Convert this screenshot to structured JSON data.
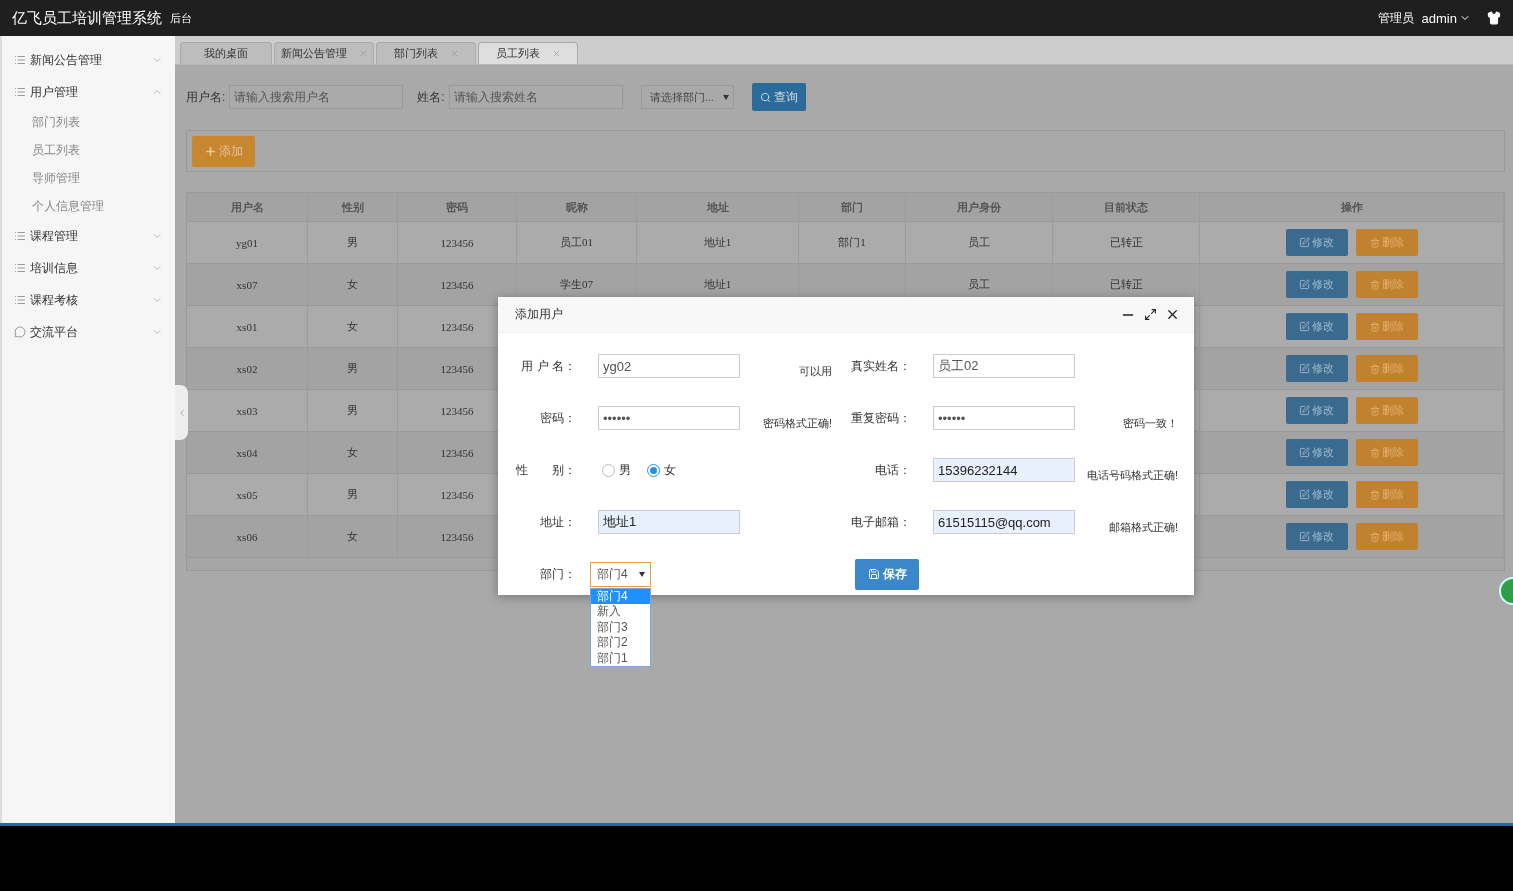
{
  "topbar": {
    "title": "亿飞员工培训管理系统",
    "subtitle": "后台",
    "role": "管理员",
    "user": "admin"
  },
  "sidebar": {
    "items": [
      {
        "label": "新闻公告管理",
        "kind": "menu",
        "expanded": false
      },
      {
        "label": "用户管理",
        "kind": "menu",
        "expanded": true,
        "children": [
          {
            "label": "部门列表"
          },
          {
            "label": "员工列表"
          },
          {
            "label": "导师管理"
          },
          {
            "label": "个人信息管理"
          }
        ]
      },
      {
        "label": "课程管理",
        "kind": "menu",
        "expanded": false
      },
      {
        "label": "培训信息",
        "kind": "menu",
        "expanded": false
      },
      {
        "label": "课程考核",
        "kind": "menu",
        "expanded": false
      },
      {
        "label": "交流平台",
        "kind": "chat",
        "expanded": false
      }
    ]
  },
  "tabs": [
    {
      "label": "我的桌面",
      "closable": false,
      "selected": false
    },
    {
      "label": "新闻公告管理",
      "closable": true,
      "selected": false
    },
    {
      "label": "部门列表",
      "closable": true,
      "selected": false
    },
    {
      "label": "员工列表",
      "closable": true,
      "selected": true
    }
  ],
  "search": {
    "username_label": "用户名:",
    "username_placeholder": "请输入搜索用户名",
    "name_label": "姓名:",
    "name_placeholder": "请输入搜索姓名",
    "department_placeholder": "请选择部门...",
    "query_button": "查询"
  },
  "add_button": "添加",
  "table": {
    "columns": [
      "用户名",
      "性别",
      "密码",
      "昵称",
      "地址",
      "部门",
      "用户身份",
      "目前状态",
      "操作"
    ],
    "rows": [
      {
        "cells": [
          "yg01",
          "男",
          "123456",
          "员工01",
          "地址1",
          "部门1",
          "员工",
          "已转正"
        ],
        "actions": [
          "修改",
          "删除"
        ]
      },
      {
        "cells": [
          "xs07",
          "女",
          "123456",
          "学生07",
          "地址1",
          null,
          "员工",
          "已转正"
        ],
        "actions": [
          "修改",
          "删除"
        ]
      },
      {
        "cells": [
          "xs01",
          "女",
          "123456"
        ],
        "actions": [
          "修改",
          "删除"
        ]
      },
      {
        "cells": [
          "xs02",
          "男",
          "123456"
        ],
        "actions": [
          "修改",
          "删除"
        ]
      },
      {
        "cells": [
          "xs03",
          "男",
          "123456"
        ],
        "actions": [
          "修改",
          "删除"
        ]
      },
      {
        "cells": [
          "xs04",
          "女",
          "123456"
        ],
        "actions": [
          "修改",
          "删除"
        ]
      },
      {
        "cells": [
          "xs05",
          "男",
          "123456"
        ],
        "actions": [
          "修改",
          "删除"
        ]
      },
      {
        "cells": [
          "xs06",
          "女",
          "123456"
        ],
        "actions": [
          "修改",
          "删除"
        ]
      }
    ]
  },
  "dialog": {
    "title": "添加用户",
    "rows": [
      {
        "left": {
          "kind": "input",
          "label": "用 户 名：",
          "value": "yg02",
          "autofilled": false,
          "hint": "可以用"
        },
        "right": {
          "kind": "input",
          "label": "真实姓名：",
          "value": "员工02",
          "autofilled": false
        }
      },
      {
        "left": {
          "kind": "input",
          "label": "密码：",
          "value": "••••••",
          "autofilled": false,
          "hint": "密码格式正确!"
        },
        "right": {
          "kind": "input",
          "label": "重复密码：",
          "value": "••••••",
          "autofilled": false,
          "hint": "密码一致！"
        }
      },
      {
        "left": {
          "kind": "radio",
          "label": "性　　别：",
          "options": [
            {
              "label": "男",
              "selected": false
            },
            {
              "label": "女",
              "selected": true
            }
          ]
        },
        "right": {
          "kind": "input",
          "label": "电话：",
          "value": "15396232144",
          "autofilled": true,
          "hint": "电话号码格式正确!"
        }
      },
      {
        "left": {
          "kind": "input",
          "label": "地址：",
          "value": "地址1",
          "autofilled": true
        },
        "right": {
          "kind": "input",
          "label": "电子邮箱：",
          "value": "61515115@qq.com",
          "autofilled": true,
          "hint": "邮箱格式正确!"
        }
      },
      {
        "left": {
          "kind": "select",
          "label": "部门：",
          "value": "部门4",
          "options": [
            {
              "label": "部门4",
              "selected": true
            },
            {
              "label": "新入",
              "selected": false
            },
            {
              "label": "部门3",
              "selected": false
            },
            {
              "label": "部门2",
              "selected": false
            },
            {
              "label": "部门1",
              "selected": false
            }
          ]
        },
        "right": {
          "kind": "button",
          "label": "保存"
        }
      }
    ]
  }
}
